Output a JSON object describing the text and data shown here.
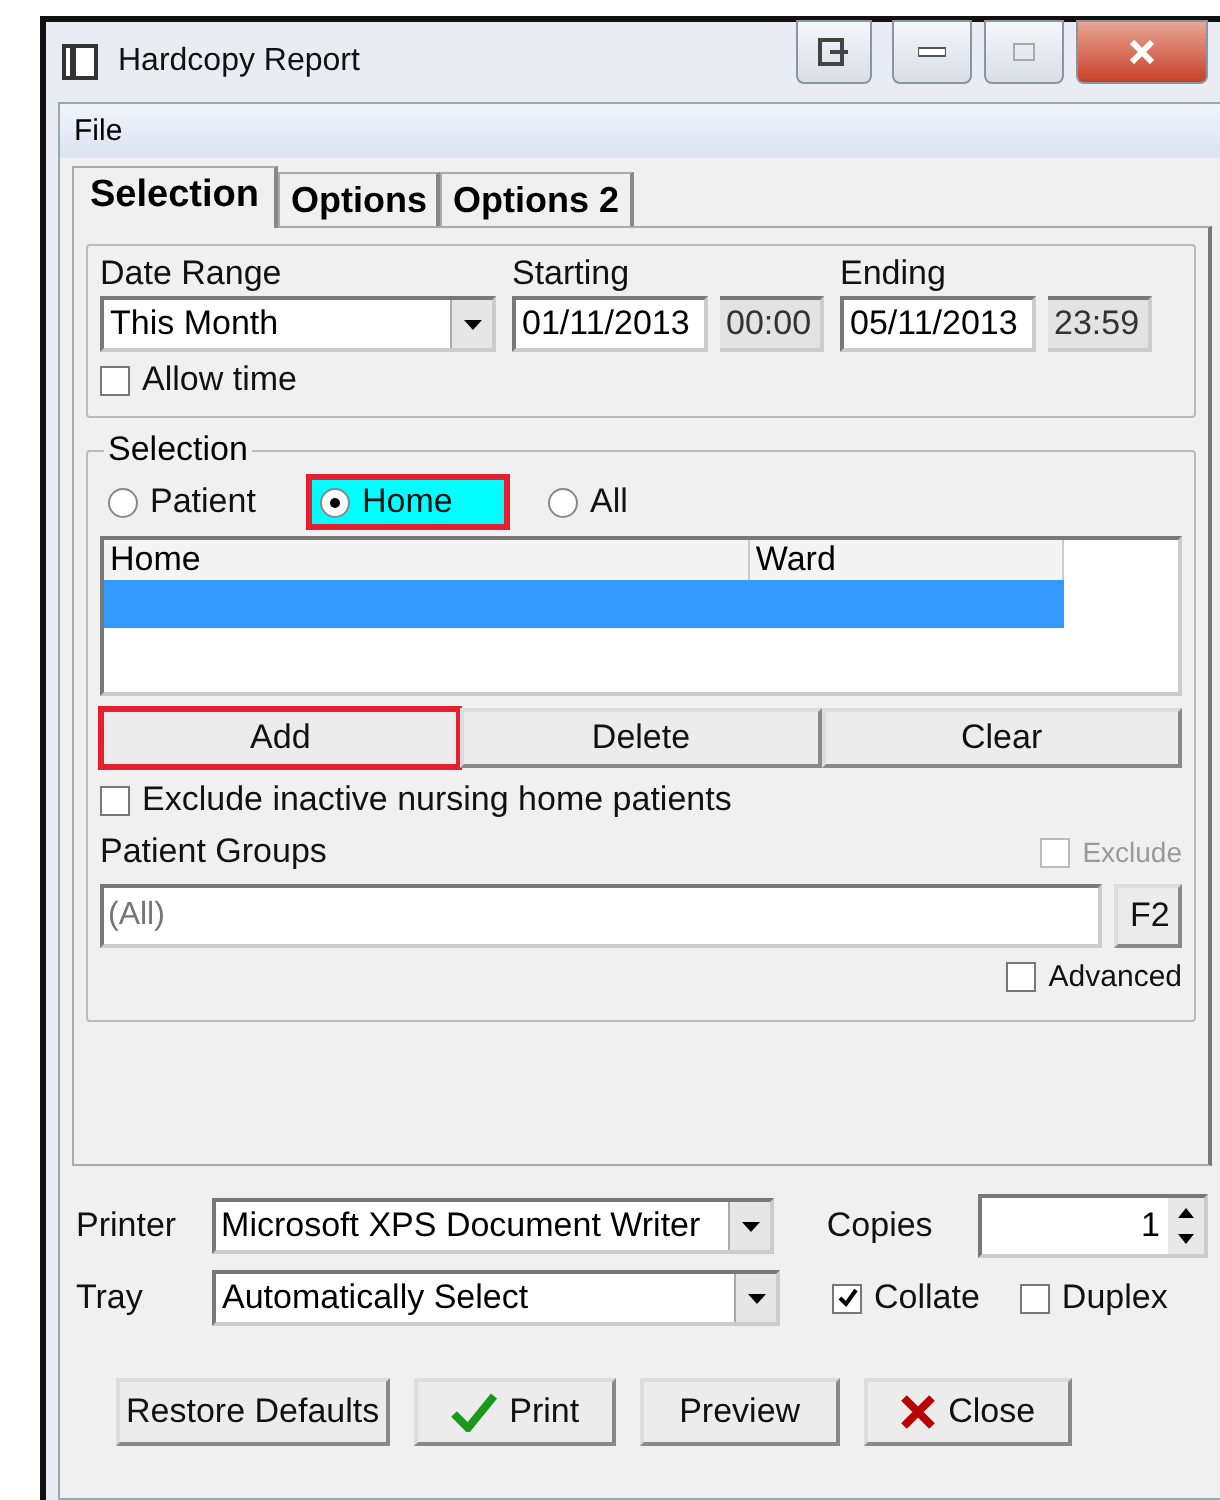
{
  "window": {
    "title": "Hardcopy Report"
  },
  "menu": [
    {
      "label": "File"
    }
  ],
  "tabs": [
    {
      "label": "Selection",
      "selected": true
    },
    {
      "label": "Options",
      "selected": false
    },
    {
      "label": "Options 2",
      "selected": false
    }
  ],
  "date_range": {
    "label": "Date Range",
    "value": "This Month"
  },
  "starting": {
    "label": "Starting",
    "date": "01/11/2013",
    "time": "00:00"
  },
  "ending": {
    "label": "Ending",
    "date": "05/11/2013",
    "time": "23:59"
  },
  "allow_time": {
    "label": "Allow time",
    "checked": false
  },
  "selection": {
    "title": "Selection",
    "radios": [
      {
        "label": "Patient",
        "selected": false,
        "highlighted": false
      },
      {
        "label": "Home",
        "selected": true,
        "highlighted": true
      },
      {
        "label": "All",
        "selected": false,
        "highlighted": false
      }
    ],
    "table": {
      "columns": [
        "Home",
        "Ward"
      ],
      "rows": [
        {
          "selected": true
        }
      ]
    },
    "buttons": [
      {
        "label": "Add",
        "highlighted": true
      },
      {
        "label": "Delete",
        "highlighted": false
      },
      {
        "label": "Clear",
        "highlighted": false
      }
    ],
    "exclude_inactive": {
      "label": "Exclude inactive nursing home patients",
      "checked": false
    },
    "patient_groups": {
      "label": "Patient Groups",
      "placeholder": "(All)",
      "button": "F2"
    },
    "exclude": {
      "label": "Exclude",
      "checked": false,
      "disabled": true
    },
    "advanced": {
      "label": "Advanced",
      "checked": false
    }
  },
  "printer": {
    "label": "Printer",
    "value": "Microsoft XPS Document Writer"
  },
  "copies": {
    "label": "Copies",
    "value": "1"
  },
  "tray": {
    "label": "Tray",
    "value": "Automatically Select"
  },
  "collate": {
    "label": "Collate",
    "checked": true
  },
  "duplex": {
    "label": "Duplex",
    "checked": false
  },
  "buttons": [
    {
      "label": "Restore Defaults",
      "kind": "plain"
    },
    {
      "label": "Print",
      "kind": "print"
    },
    {
      "label": "Preview",
      "kind": "plain"
    },
    {
      "label": "Close",
      "kind": "close"
    }
  ]
}
